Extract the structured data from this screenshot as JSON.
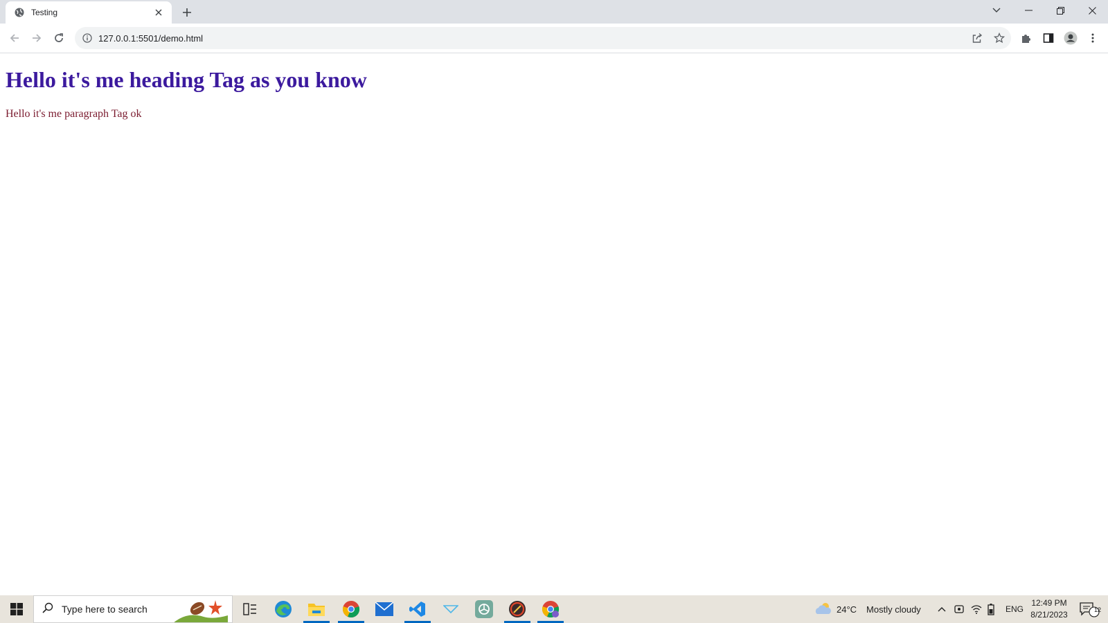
{
  "browser": {
    "tab_title": "Testing",
    "url": "127.0.0.1:5501/demo.html"
  },
  "page": {
    "heading": "Hello it's me heading Tag as you know",
    "paragraph": "Hello it's me paragraph Tag ok",
    "heading_color": "#3c1a9e",
    "paragraph_color": "#7a1a2e"
  },
  "taskbar": {
    "search_placeholder": "Type here to search",
    "weather_temp": "24°C",
    "weather_desc": "Mostly cloudy",
    "language": "ENG",
    "time": "12:49 PM",
    "date": "8/21/2023",
    "notification_count": "12",
    "apps": [
      "task-view",
      "edge",
      "file-explorer",
      "chrome",
      "mail",
      "vscode",
      "app-arrow",
      "chatgpt",
      "app-round",
      "chrome-profile"
    ]
  }
}
